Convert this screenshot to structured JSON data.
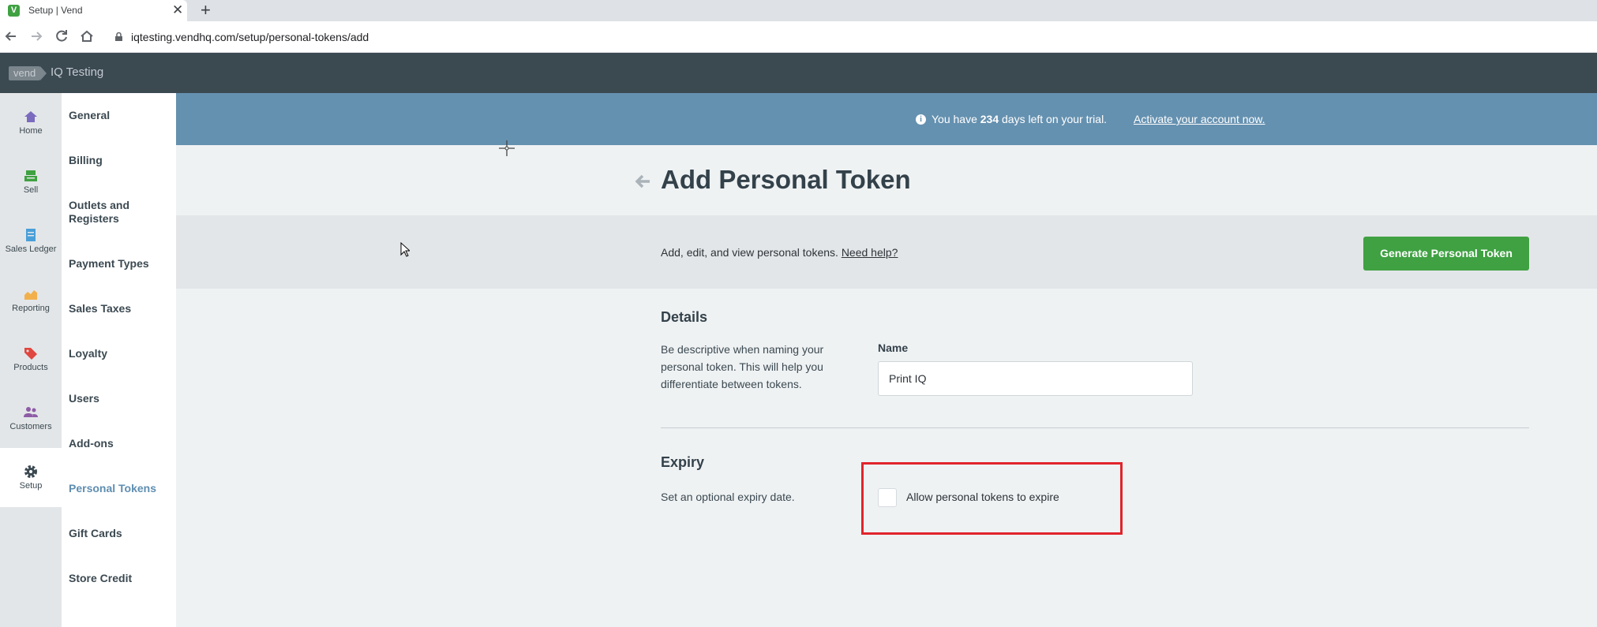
{
  "browser": {
    "tab_title": "Setup | Vend",
    "favicon_letter": "V",
    "close_glyph": "✕",
    "new_tab_glyph": "+",
    "url": "iqtesting.vendhq.com/setup/personal-tokens/add"
  },
  "header": {
    "logo_text": "vend",
    "store_name": "IQ Testing"
  },
  "leftnav": {
    "items": [
      {
        "label": "Home",
        "icon": "home-icon",
        "color": "#7a6bbf"
      },
      {
        "label": "Sell",
        "icon": "register-icon",
        "color": "#3fa142"
      },
      {
        "label": "Sales Ledger",
        "icon": "ledger-icon",
        "color": "#4a9fd8"
      },
      {
        "label": "Reporting",
        "icon": "chart-icon",
        "color": "#f2b04b"
      },
      {
        "label": "Products",
        "icon": "tag-icon",
        "color": "#e0473f"
      },
      {
        "label": "Customers",
        "icon": "people-icon",
        "color": "#8e5ca7"
      },
      {
        "label": "Setup",
        "icon": "gear-icon",
        "color": "#3b4951"
      }
    ]
  },
  "submenu": {
    "items": [
      {
        "label": "General"
      },
      {
        "label": "Billing"
      },
      {
        "label": "Outlets and Registers"
      },
      {
        "label": "Payment Types"
      },
      {
        "label": "Sales Taxes"
      },
      {
        "label": "Loyalty"
      },
      {
        "label": "Users"
      },
      {
        "label": "Add-ons"
      },
      {
        "label": "Personal Tokens"
      },
      {
        "label": "Gift Cards"
      },
      {
        "label": "Store Credit"
      }
    ],
    "active": "Personal Tokens"
  },
  "banner": {
    "text_before": "You have ",
    "days": "234",
    "text_after": " days left on your trial.",
    "link": "Activate your account now."
  },
  "page": {
    "title": "Add Personal Token"
  },
  "toolbar": {
    "description": "Add, edit, and view personal tokens. ",
    "help_link": "Need help?",
    "generate_button": "Generate Personal Token"
  },
  "details": {
    "title": "Details",
    "description": "Be descriptive when naming your personal token. This will help you differentiate between tokens.",
    "name_label": "Name",
    "name_value": "Print IQ"
  },
  "expiry": {
    "title": "Expiry",
    "description": "Set an optional expiry date.",
    "checkbox_label": "Allow personal tokens to expire",
    "checked": false
  },
  "colors": {
    "banner": "#6591b0",
    "header": "#3b4951",
    "primary_button": "#3fa142",
    "highlight": "#e0242b",
    "active_link": "#5e8eb1"
  }
}
